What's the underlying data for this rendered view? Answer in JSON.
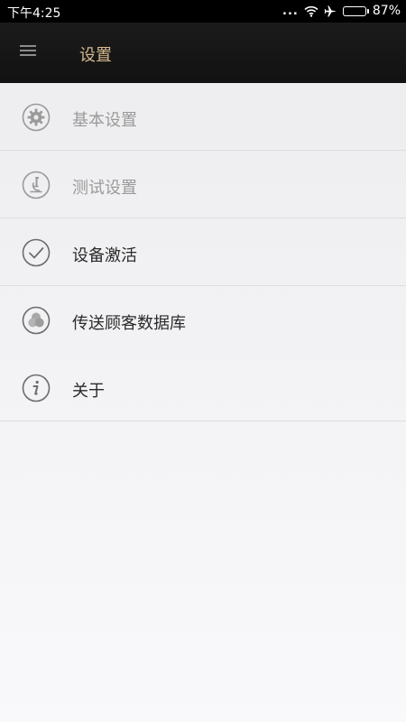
{
  "status_bar": {
    "time": "下午4:25",
    "dots": "...",
    "battery_percent": "87%",
    "battery_level": 0.87,
    "icons": [
      "wifi-icon",
      "airplane-icon",
      "battery-icon"
    ]
  },
  "header": {
    "title": "设置",
    "menu_icon": "hamburger-menu-icon",
    "title_color": "#d6b98e"
  },
  "menu": {
    "items": [
      {
        "label": "基本设置",
        "icon": "gear-icon",
        "enabled": false
      },
      {
        "label": "测试设置",
        "icon": "microscope-icon",
        "enabled": false
      },
      {
        "label": "设备激活",
        "icon": "checkmark-icon",
        "enabled": true
      },
      {
        "label": "传送顾客数据库",
        "icon": "database-circles-icon",
        "enabled": true
      },
      {
        "label": "关于",
        "icon": "info-icon",
        "enabled": true
      }
    ]
  },
  "colors": {
    "header_bg": "#161616",
    "disabled_text": "#9a9a9a",
    "enabled_text": "#2a2a2a",
    "divider": "#dedee0"
  }
}
